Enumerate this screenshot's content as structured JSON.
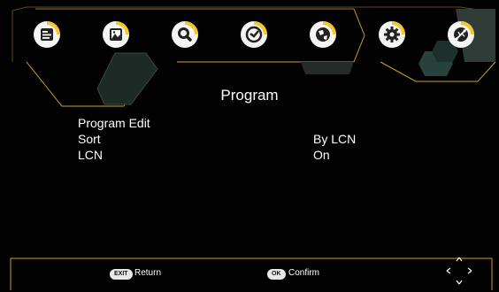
{
  "top_bar": {
    "icons": [
      "channel-list-icon",
      "picture-icon",
      "search-icon",
      "clock-icon",
      "globe-icon",
      "settings-gear-icon",
      "usb-icon"
    ],
    "active_index": 5
  },
  "page": {
    "title": "Program"
  },
  "menu": {
    "items": [
      {
        "label": "Program Edit",
        "value": ""
      },
      {
        "label": "Sort",
        "value": "By LCN"
      },
      {
        "label": "LCN",
        "value": "On"
      }
    ]
  },
  "footer": {
    "exit_key": "EXIT",
    "exit_label": "Return",
    "ok_key": "OK",
    "ok_label": "Confirm",
    "nav_icon": "direction-pad-icon"
  },
  "colors": {
    "accent_gold": "#c9a227",
    "icon_yellow": "#f2c318",
    "teal": "#2f4a40",
    "background": "#000000",
    "text": "#ffffff"
  }
}
